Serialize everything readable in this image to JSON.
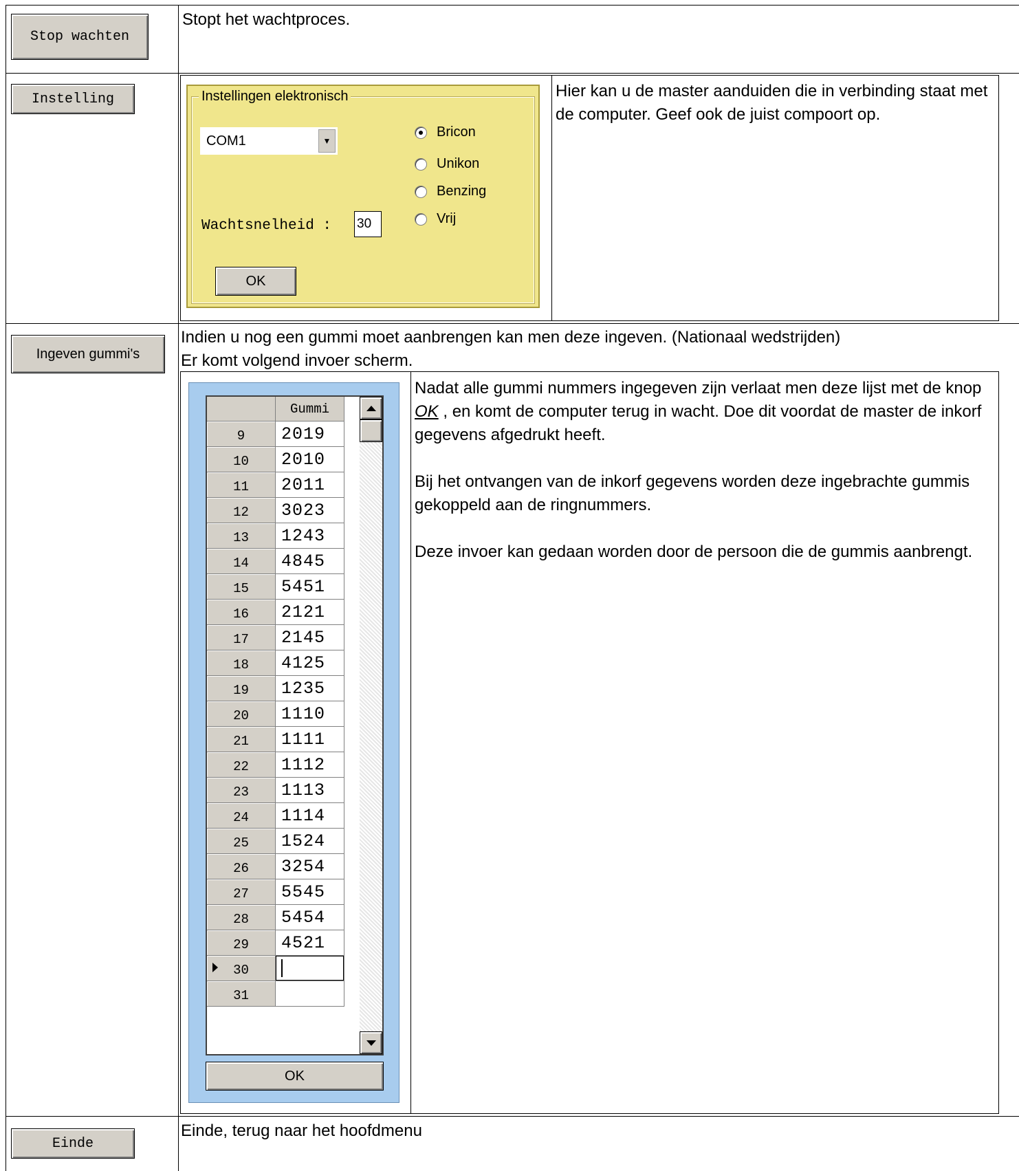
{
  "rows": {
    "stop": {
      "button_label": "Stop wachten",
      "description": "Stopt het wachtproces."
    },
    "instelling": {
      "button_label": "Instelling",
      "description": "Hier kan u de master aanduiden die in verbinding staat met de computer. Geef ook de juist compoort op.",
      "dialog": {
        "group_title": "Instellingen elektronisch",
        "port_value": "COM1",
        "radio_options": [
          "Bricon",
          "Unikon",
          "Benzing",
          "Vrij"
        ],
        "selected_option": "Bricon",
        "speed_label": "Wachtsnelheid :",
        "speed_value": "30",
        "ok_label": "OK"
      }
    },
    "gummi": {
      "button_label": "Ingeven gummi's",
      "intro_line1": "Indien u nog een gummi moet aanbrengen kan men deze ingeven. (Nationaal wedstrijden)",
      "intro_line2": "Er komt volgend invoer scherm.",
      "para1_before": "Nadat alle gummi nummers ingegeven zijn verlaat men deze lijst met de knop ",
      "para1_link": "OK",
      "para1_after": " , en komt de computer terug in wacht. Doe dit voordat de master de inkorf gegevens afgedrukt heeft.",
      "para2": "Bij het ontvangen van de inkorf gegevens worden deze ingebrachte  gummis gekoppeld aan de ringnummers.",
      "para3": "Deze invoer kan gedaan worden door de persoon die de gummis aanbrengt.",
      "dialog": {
        "column_header": "Gummi",
        "ok_label": "OK",
        "current_row": "30",
        "rows": [
          {
            "num": "9",
            "gummi": "2019"
          },
          {
            "num": "10",
            "gummi": "2010"
          },
          {
            "num": "11",
            "gummi": "2011"
          },
          {
            "num": "12",
            "gummi": "3023"
          },
          {
            "num": "13",
            "gummi": "1243"
          },
          {
            "num": "14",
            "gummi": "4845"
          },
          {
            "num": "15",
            "gummi": "5451"
          },
          {
            "num": "16",
            "gummi": "2121"
          },
          {
            "num": "17",
            "gummi": "2145"
          },
          {
            "num": "18",
            "gummi": "4125"
          },
          {
            "num": "19",
            "gummi": "1235"
          },
          {
            "num": "20",
            "gummi": "1110"
          },
          {
            "num": "21",
            "gummi": "1111"
          },
          {
            "num": "22",
            "gummi": "1112"
          },
          {
            "num": "23",
            "gummi": "1113"
          },
          {
            "num": "24",
            "gummi": "1114"
          },
          {
            "num": "25",
            "gummi": "1524"
          },
          {
            "num": "26",
            "gummi": "3254"
          },
          {
            "num": "27",
            "gummi": "5545"
          },
          {
            "num": "28",
            "gummi": "5454"
          },
          {
            "num": "29",
            "gummi": "4521"
          },
          {
            "num": "30",
            "gummi": ""
          },
          {
            "num": "31",
            "gummi": ""
          }
        ]
      }
    },
    "einde": {
      "button_label": "Einde",
      "description": "Einde, terug naar het hoofdmenu"
    }
  }
}
